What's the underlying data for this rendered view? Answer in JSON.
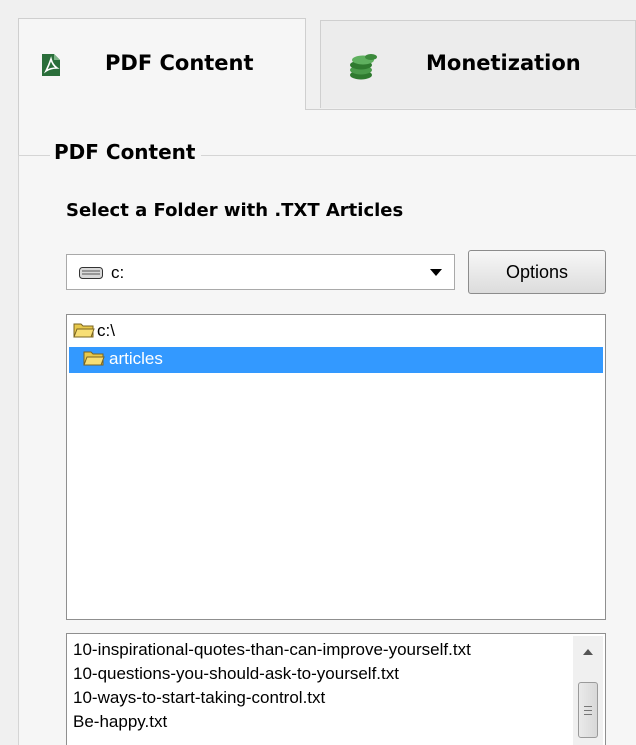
{
  "tabs": [
    {
      "label": "PDF Content",
      "icon": "pdf-icon",
      "active": true
    },
    {
      "label": "Monetization",
      "icon": "coins-icon",
      "active": false
    }
  ],
  "group": {
    "title": "PDF Content",
    "folder_heading": "Select a Folder with .TXT Articles"
  },
  "drive": {
    "value": "c:",
    "icon": "drive-icon"
  },
  "options_label": "Options",
  "folder_tree": {
    "root": "c:\\",
    "selected": "articles"
  },
  "files": [
    "10-inspirational-quotes-than-can-improve-yourself.txt",
    "10-questions-you-should-ask-to-yourself.txt",
    "10-ways-to-start-taking-control.txt",
    "Be-happy.txt"
  ],
  "colors": {
    "selection": "#3399ff",
    "pdf_icon": "#2a6e3a",
    "coins_icon": "#3c8a3c"
  }
}
